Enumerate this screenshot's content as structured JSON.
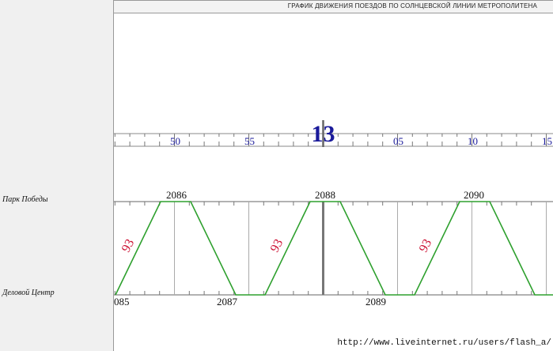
{
  "header": {
    "title": "ГРАФИК ДВИЖЕНИЯ ПОЕЗДОВ ПО СОЛНЦЕВСКОЙ ЛИНИИ МЕТРОПОЛИТЕНА"
  },
  "stations": {
    "top": "Парк Победы",
    "bottom": "Деловой Центр"
  },
  "timeline": {
    "hour_label": "13",
    "minute_labels": [
      "50",
      "55",
      "05",
      "10",
      "15"
    ]
  },
  "trains": {
    "top_numbers": [
      "2086",
      "2088",
      "2090"
    ],
    "bottom_numbers": [
      "085",
      "2087",
      "2089"
    ],
    "run_time_label": "93"
  },
  "colors": {
    "train_line": "#2ea02e",
    "run_time": "#cc1133",
    "minute": "#1a1a9a",
    "hour": "#1a1a9a"
  },
  "footer": {
    "url": "http://www.liveinternet.ru/users/flash_a/"
  }
}
